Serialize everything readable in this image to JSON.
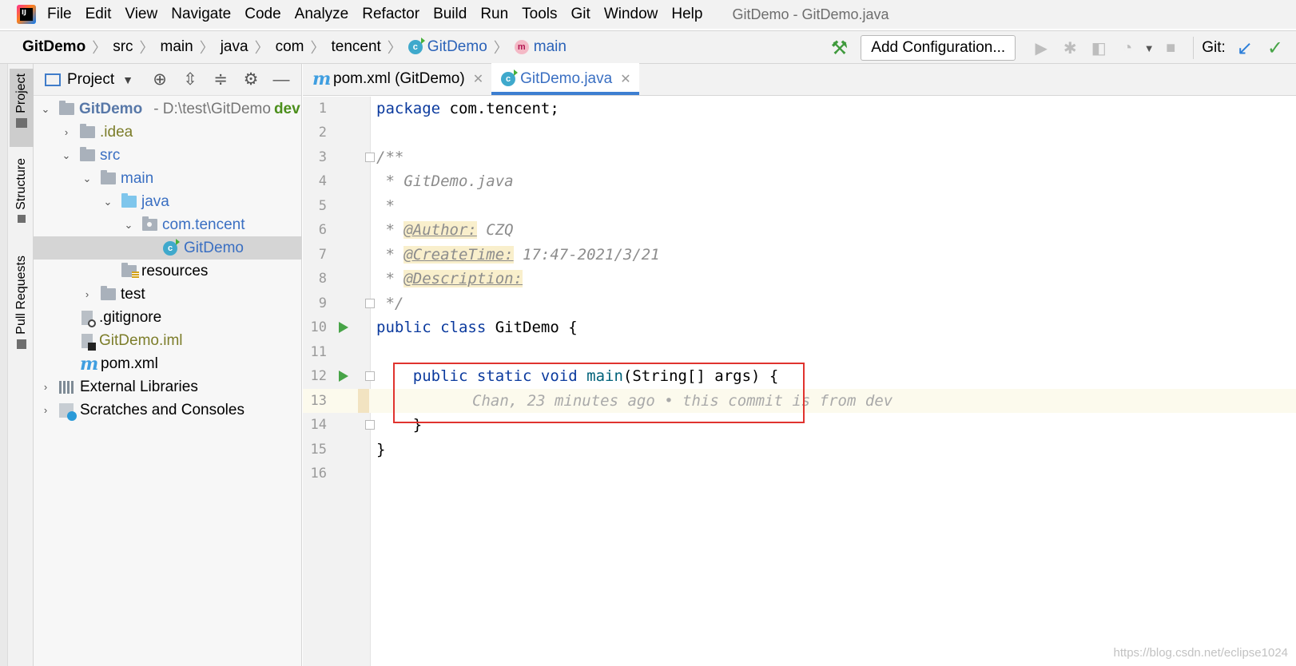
{
  "menubar": {
    "items": [
      "File",
      "Edit",
      "View",
      "Navigate",
      "Code",
      "Analyze",
      "Refactor",
      "Build",
      "Run",
      "Tools",
      "Git",
      "Window",
      "Help"
    ],
    "window_title": "GitDemo - GitDemo.java"
  },
  "navbar": {
    "crumbs": [
      "GitDemo",
      "src",
      "main",
      "java",
      "com",
      "tencent",
      "GitDemo",
      "main"
    ],
    "add_configuration": "Add Configuration...",
    "git_label": "Git:"
  },
  "stripe": {
    "project": "Project",
    "structure": "Structure",
    "pull_requests": "Pull Requests"
  },
  "project_panel": {
    "title": "Project",
    "root_name": "GitDemo",
    "root_path": "- D:\\test\\GitDemo",
    "root_branch": "dev",
    "idea": ".idea",
    "src": "src",
    "main": "main",
    "java": "java",
    "package": "com.tencent",
    "class_file": "GitDemo",
    "resources": "resources",
    "test": "test",
    "gitignore": ".gitignore",
    "iml": "GitDemo.iml",
    "pom": "pom.xml",
    "external_libraries": "External Libraries",
    "scratches": "Scratches and Consoles"
  },
  "tabs": {
    "pom": "pom.xml (GitDemo)",
    "java": "GitDemo.java"
  },
  "editor": {
    "line_numbers": [
      "1",
      "2",
      "3",
      "4",
      "5",
      "6",
      "7",
      "8",
      "9",
      "10",
      "11",
      "12",
      "13",
      "14",
      "15",
      "16"
    ],
    "l1_kw": "package",
    "l1_rest": " com.tencent;",
    "l3": "/**",
    "l4": " * GitDemo.java",
    "l5": " *",
    "l6_prefix": " * ",
    "l6_tag": "@Author:",
    "l6_rest": " CZQ",
    "l7_prefix": " * ",
    "l7_tag": "@CreateTime:",
    "l7_rest": " 17:47-2021/3/21",
    "l8_prefix": " * ",
    "l8_tag": "@Description:",
    "l9": " */",
    "l10_kw": "public class",
    "l10_rest": " GitDemo {",
    "l12_indent": "    ",
    "l12_kw": "public static void",
    "l12_space": " ",
    "l12_fn": "main",
    "l12_rest": "(String[] args) {",
    "l13_inlay": "Chan, 23 minutes ago • this commit is from dev",
    "l14": "    }",
    "l15": "}"
  },
  "watermark": "https://blog.csdn.net/eclipse1024"
}
